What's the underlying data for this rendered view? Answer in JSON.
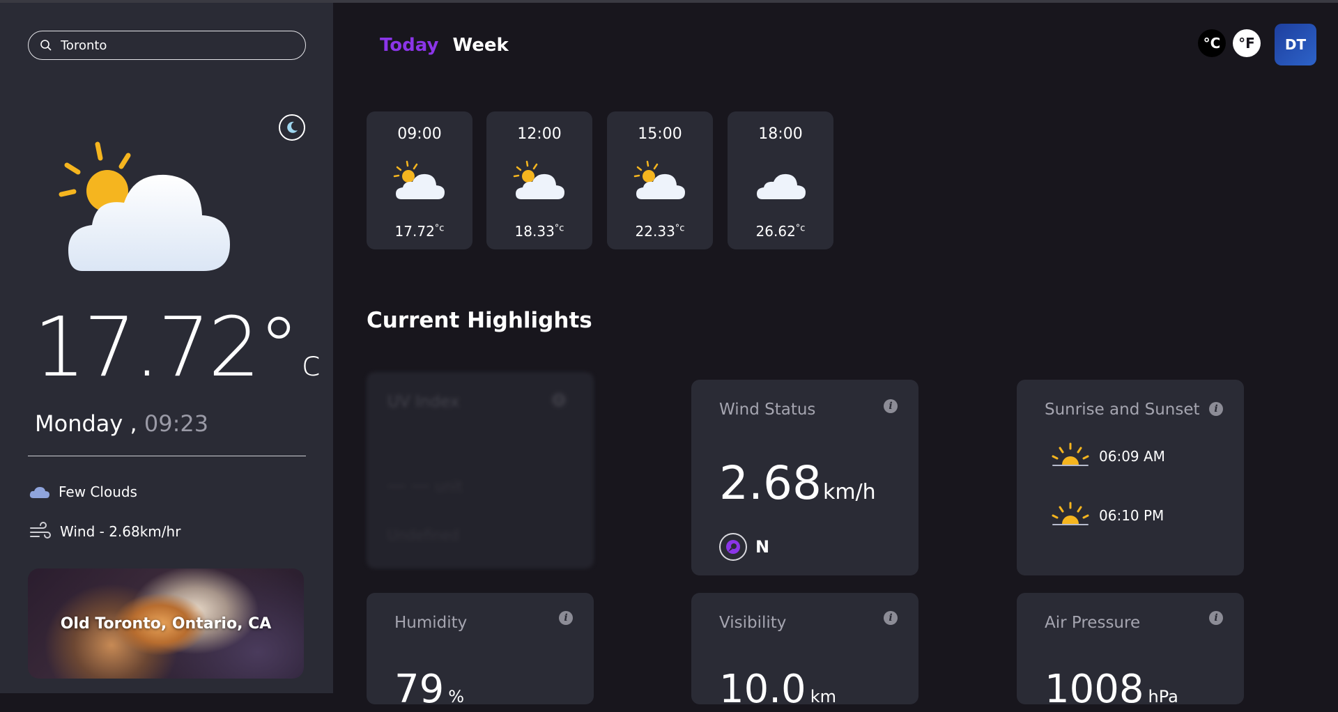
{
  "search": {
    "value": "Toronto",
    "icon": "search-icon"
  },
  "sidebar": {
    "theme_toggle_icon": "moon-icon",
    "temperature": "17.72°",
    "temperature_unit": "c",
    "day": "Monday ,",
    "time": "09:23",
    "condition": "Few Clouds",
    "wind": "Wind - 2.68km/hr",
    "place": "Old Toronto, Ontario, CA"
  },
  "tabs": {
    "today": "Today",
    "week": "Week"
  },
  "header": {
    "celsius": "°C",
    "fahrenheit": "°F",
    "avatar_initials": "DT"
  },
  "hourly": [
    {
      "time": "09:00",
      "temp": "17.72",
      "unit": "°c",
      "icon": "partly-cloudy-day-icon"
    },
    {
      "time": "12:00",
      "temp": "18.33",
      "unit": "°c",
      "icon": "partly-cloudy-day-icon"
    },
    {
      "time": "15:00",
      "temp": "22.33",
      "unit": "°c",
      "icon": "partly-cloudy-day-icon"
    },
    {
      "time": "18:00",
      "temp": "26.62",
      "unit": "°c",
      "icon": "partly-cloudy-night-icon"
    }
  ],
  "highlights": {
    "title": "Current Highlights",
    "uv": {
      "title": "UV Index",
      "value": "— —",
      "unit": "unit",
      "desc": "Undefined"
    },
    "wind": {
      "title": "Wind Status",
      "value": "2.68",
      "unit": "km/h",
      "direction": "N"
    },
    "sun": {
      "title": "Sunrise and Sunset",
      "sunrise": "06:09 AM",
      "sunset": "06:10 PM"
    },
    "humidity": {
      "title": "Humidity",
      "value": "79",
      "unit": "%"
    },
    "visibility": {
      "title": "Visibility",
      "value": "10.0",
      "unit": "km"
    },
    "pressure": {
      "title": "Air Pressure",
      "value": "1008",
      "unit": "hPa"
    }
  },
  "colors": {
    "accent": "#8b35e8",
    "card": "#2a2b35",
    "background": "#18161d",
    "sun": "#f5b51f"
  }
}
